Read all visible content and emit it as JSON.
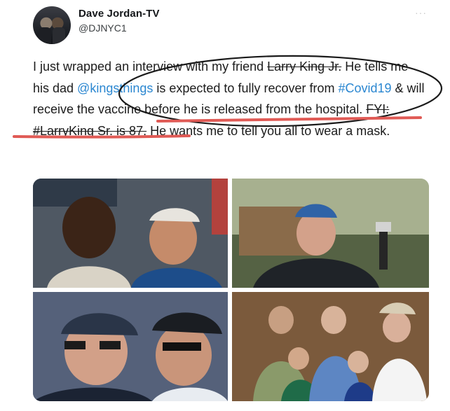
{
  "tweet": {
    "display_name": "Dave Jordan-TV",
    "handle": "@DJNYC1",
    "more_icon": "more-dots-icon",
    "text": {
      "t1": "I just wrapped an interview with my friend ",
      "t2": "Larry King Jr.",
      "t3": " He tells me his dad ",
      "mention": "@kingsthings",
      "t4": " is expected to fully recover from ",
      "hashtag1": "#Covid19",
      "t5": " & will receive the  vaccine before he is released from the hospital. ",
      "strike_text": "FYI: #LarryKing Sr. is 87.",
      "t6": " He wants me to tell you all to wear a mask."
    },
    "colors": {
      "link": "#2b87d1",
      "annotation": "#e05a55",
      "ink": "#1c1c1c"
    },
    "photos": [
      "photo-top-left",
      "photo-top-right",
      "photo-bottom-left",
      "photo-bottom-right"
    ]
  }
}
